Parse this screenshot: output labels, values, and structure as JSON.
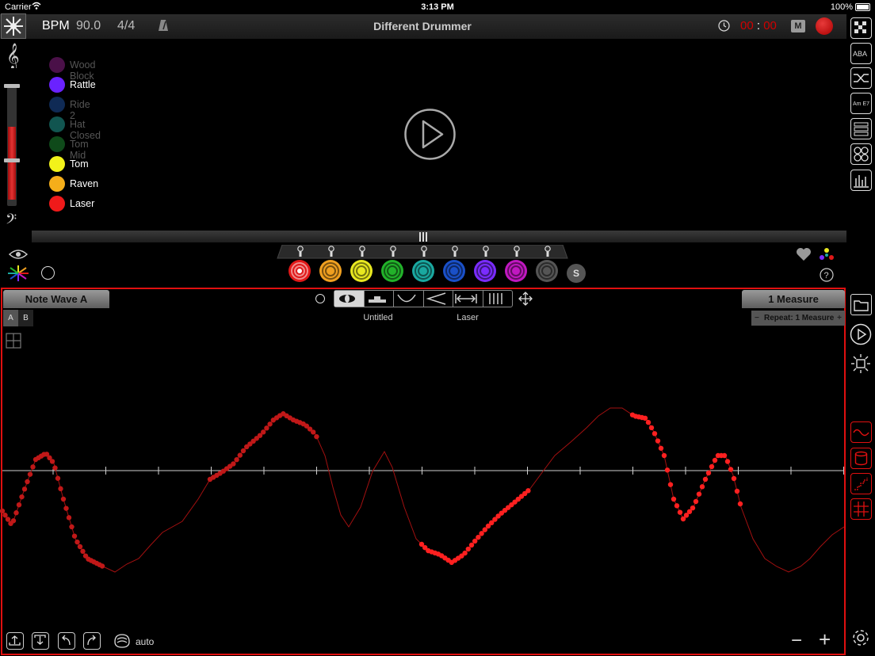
{
  "status": {
    "carrier": "Carrier",
    "time": "3:13 PM",
    "battery": "100%"
  },
  "header": {
    "bpm_label": "BPM",
    "bpm_value": "90.0",
    "time_signature": "4/4",
    "title": "Different Drummer",
    "timer_min": "00",
    "timer_sep": ":",
    "timer_sec": "00",
    "m_label": "M"
  },
  "instruments": [
    {
      "label": "Wood Block",
      "color": "#4a1048",
      "dim": true
    },
    {
      "label": "Rattle",
      "color": "#6a22ff",
      "dim": false
    },
    {
      "label": "Ride 2",
      "color": "#0f2a55",
      "dim": true
    },
    {
      "label": "Hat Closed",
      "color": "#115550",
      "dim": true
    },
    {
      "label": "Tom Mid",
      "color": "#0f4a1a",
      "dim": true
    },
    {
      "label": "Tom",
      "color": "#f2f21a",
      "dim": false
    },
    {
      "label": "Raven",
      "color": "#f5ae1a",
      "dim": false
    },
    {
      "label": "Laser",
      "color": "#f01a1a",
      "dim": false
    }
  ],
  "pads": [
    "#e01818",
    "#f0a020",
    "#e8e820",
    "#22b22a",
    "#1aa8a0",
    "#1a50c8",
    "#7a2cff",
    "#c018c0",
    "#555555"
  ],
  "solo_label": "S",
  "editor": {
    "note_tab": "Note Wave A",
    "measure_tab": "1 Measure",
    "repeat_minus": "−",
    "repeat_label": "Repeat: 1 Measure",
    "repeat_plus": "+",
    "ab_a": "A",
    "ab_b": "B",
    "pattern_name": "Untitled",
    "instrument_name": "Laser",
    "auto_label": "auto",
    "zoom_out": "−",
    "zoom_in": "+"
  },
  "icons": [
    "logo-icon",
    "treble-clef-icon",
    "bass-clef-icon",
    "metronome-icon",
    "clock-icon",
    "record-button",
    "eye-icon",
    "color-burst-icon",
    "heart-icon",
    "palette-icon",
    "help-icon",
    "move-icon",
    "folder-icon",
    "play-icon",
    "brightness-icon",
    "wave-icon",
    "cylinder-icon",
    "ramp-icon",
    "grid-icon",
    "settings-icon"
  ],
  "colors": {
    "accent": "#e01010",
    "wave_line": "#a31010",
    "dots_dark": "#c01818",
    "dots_bright": "#ff2020"
  }
}
